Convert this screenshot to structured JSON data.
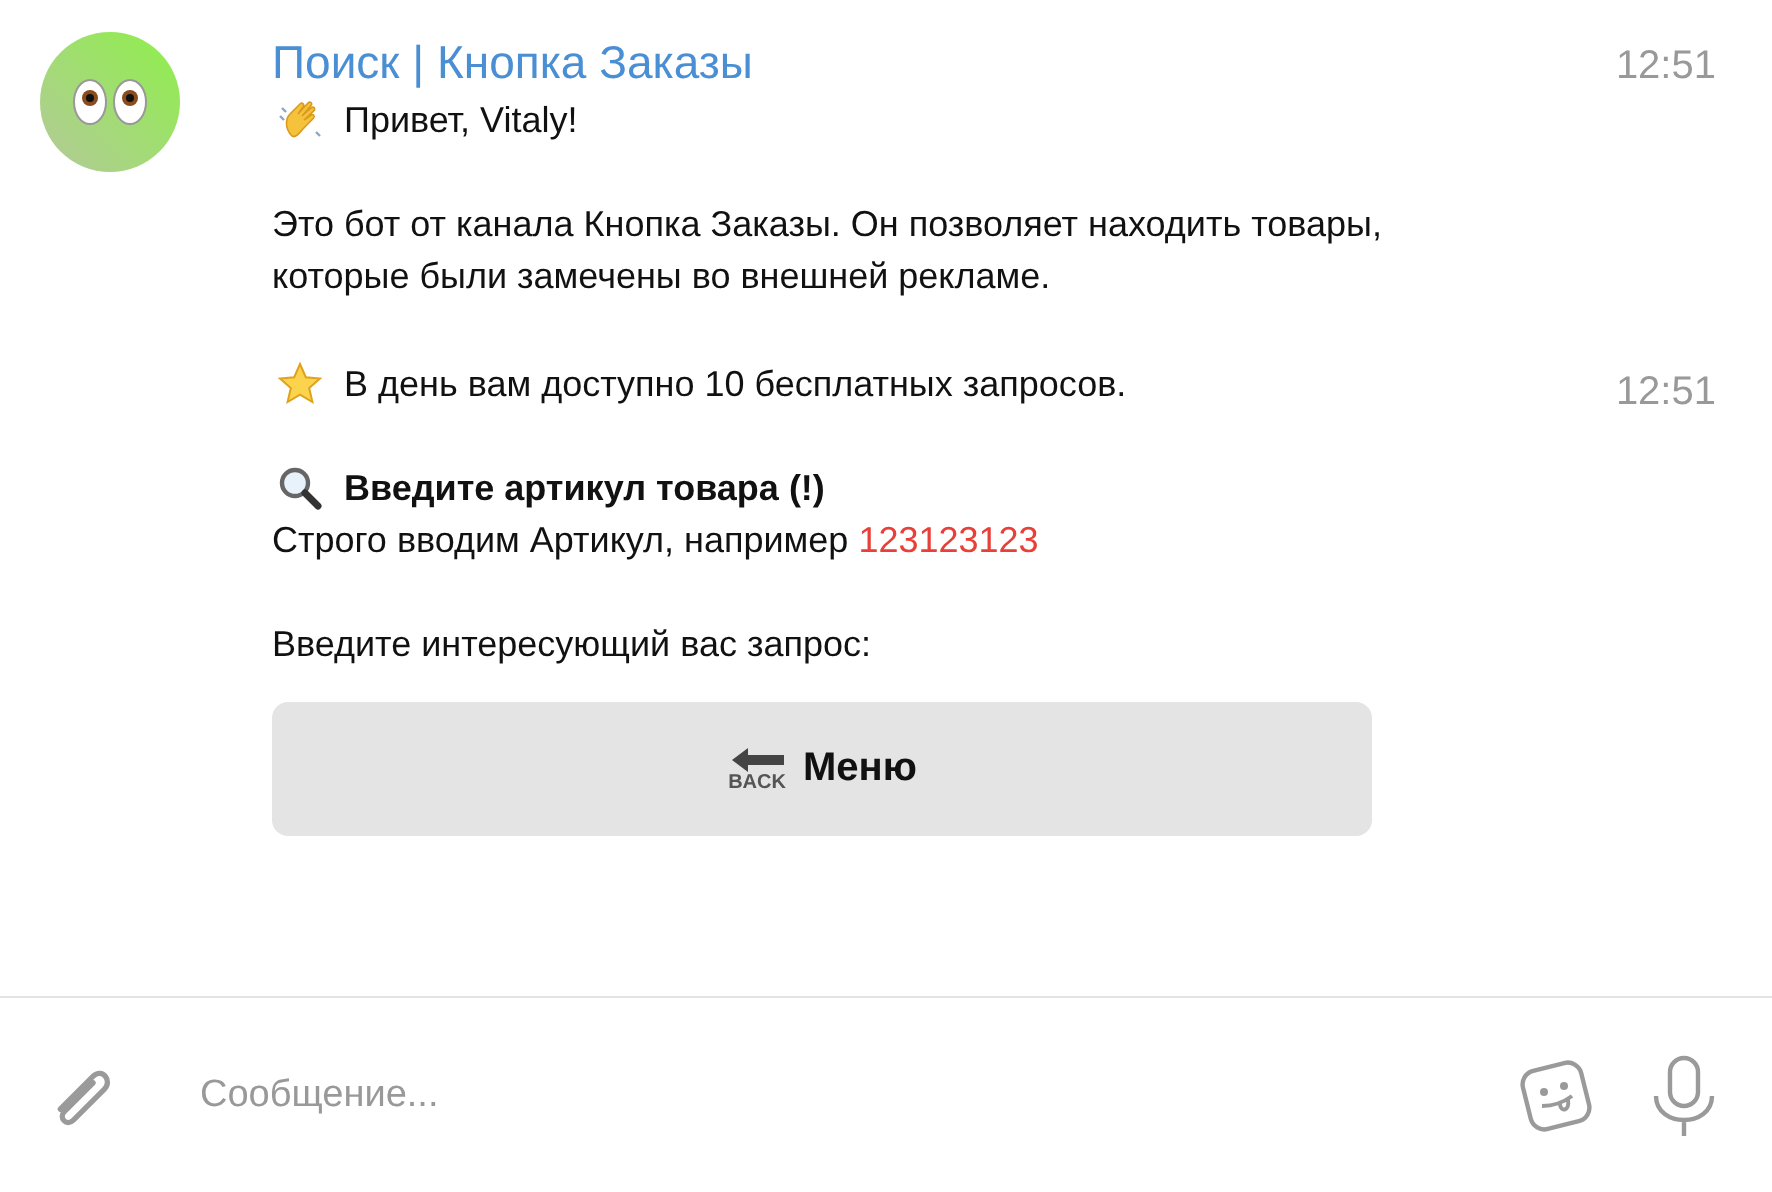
{
  "chat": {
    "sender": "Поиск | Кнопка Заказы",
    "messages": [
      {
        "time": "12:51",
        "paragraphs": [
          [
            {
              "kind": "greeting",
              "text": "Привет, Vitaly!"
            }
          ],
          [
            {
              "kind": "plain",
              "text": "Это бот от канала Кнопка Заказы. Он позволяет находить товары, которые были замечены во внешней рекламе."
            }
          ]
        ]
      },
      {
        "time": "12:51",
        "paragraphs": [
          [
            {
              "kind": "notice",
              "text": "В день вам доступно 10 бесплатных запросов."
            }
          ],
          [
            {
              "kind": "heading",
              "text": "Введите артикул товара (!)"
            },
            {
              "kind": "plain",
              "text": "Строго вводим Артикул, например ",
              "link": "123123123"
            }
          ],
          [
            {
              "kind": "plain",
              "text": "Введите интересующий вас запрос:"
            }
          ]
        ]
      }
    ],
    "keyboard": [
      {
        "icon_label": "BACK",
        "label": "Меню"
      }
    ]
  },
  "composer": {
    "placeholder": "Сообщение..."
  }
}
